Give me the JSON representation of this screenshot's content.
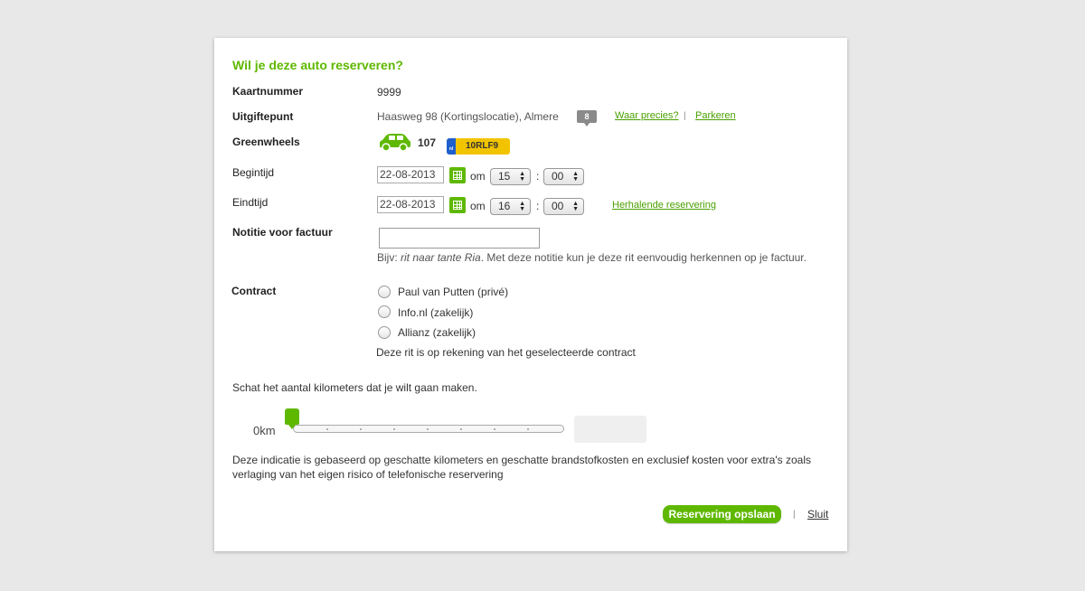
{
  "dialog": {
    "title": "Wil je deze auto reserveren?",
    "card_label": "Kaartnummer",
    "card_value": "9999",
    "location_label": "Uitgiftepunt",
    "location_value": "Haasweg 98 (Kortingslocatie), Almere",
    "location_count": "8",
    "where_link": "Waar precies?",
    "sep1": "|",
    "parking_link": "Parkeren",
    "car_label": "Greenwheels",
    "car_number": "107",
    "plate_country": "nl",
    "plate": "10RLF9",
    "start_label": "Begintijd",
    "start_date": "22-08-2013",
    "start_om": "om",
    "start_hour": "15",
    "start_colon": ":",
    "start_min": "00",
    "end_label": "Eindtijd",
    "end_date": "22-08-2013",
    "end_om": "om",
    "end_hour": "16",
    "end_colon": ":",
    "end_min": "00",
    "recurring_link": "Herhalende reservering",
    "note_label": "Notitie voor factuur",
    "note_value": "",
    "note_hint_prefix": "Bijv: ",
    "note_hint_example": "rit naar tante Ria",
    "note_hint_suffix": ". Met deze notitie kun je deze rit eenvoudig herkennen op je factuur.",
    "contract_label": "Contract",
    "contracts": [
      "Paul van Putten (privé)",
      "Info.nl (zakelijk)",
      "Allianz (zakelijk)"
    ],
    "contract_hint": "Deze rit is op rekening van het geselecteerde contract",
    "km_question": "Schat het aantal kilometers dat je wilt gaan maken.",
    "km_value": "0",
    "km_unit": "km",
    "km_slider_fraction": 0,
    "disclaimer": "Deze indicatie is gebaseerd op geschatte kilometers en geschatte brandstofkosten en exclusief kosten voor extra's zoals verlaging van het eigen risico of telefonische reservering",
    "save_button": "Reservering opslaan",
    "sep2": "|",
    "close_link": "Sluit"
  },
  "colors": {
    "accent": "#5fb800",
    "link": "#4aa000",
    "plate": "#f2c400"
  },
  "icons": {
    "car": "car-icon",
    "calendar": "calendar-icon",
    "select_arrows": "updown-arrows-icon"
  }
}
